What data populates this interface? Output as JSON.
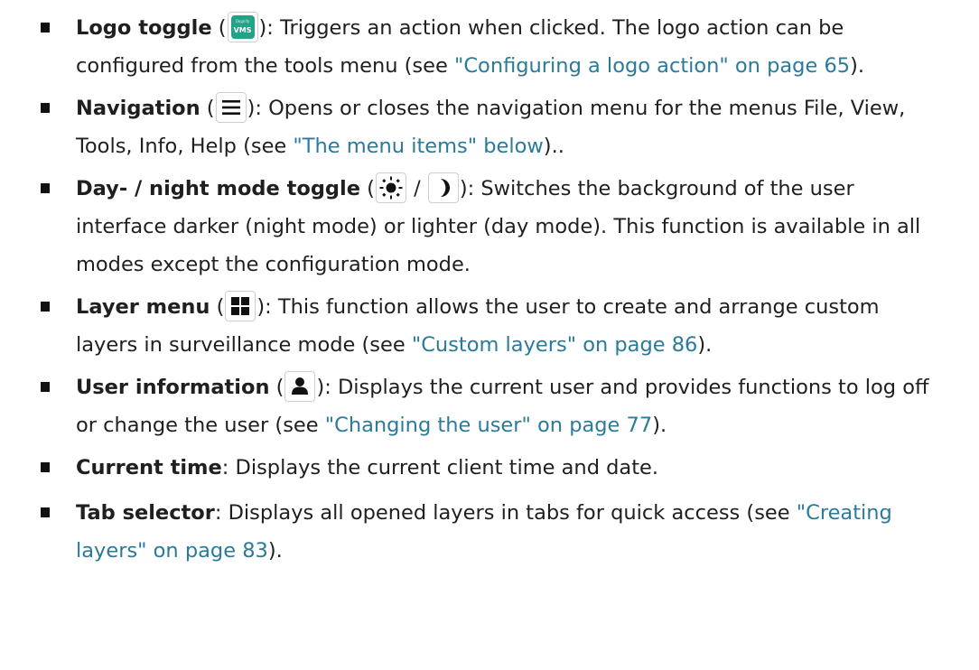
{
  "items": [
    {
      "parts": [
        {
          "t": "b",
          "text": "Logo toggle"
        },
        {
          "t": "s",
          "text": " ("
        },
        {
          "t": "icon",
          "icon": "logo-icon",
          "small": "Qognify",
          "big": "VMS"
        },
        {
          "t": "s",
          "text": "): Triggers an action when clicked. The logo action can be configured from the tools menu (see "
        },
        {
          "t": "a",
          "text": "\"Configuring a logo action\" on page 65"
        },
        {
          "t": "s",
          "text": ")."
        }
      ]
    },
    {
      "parts": [
        {
          "t": "b",
          "text": "Navigation"
        },
        {
          "t": "s",
          "text": " ("
        },
        {
          "t": "icon",
          "icon": "hamburger-menu-icon"
        },
        {
          "t": "s",
          "text": "): Opens or closes the navigation menu for the menus File, View, Tools, Info, Help (see "
        },
        {
          "t": "a",
          "text": "\"The menu items\" below"
        },
        {
          "t": "s",
          "text": ").."
        }
      ]
    },
    {
      "parts": [
        {
          "t": "b",
          "text": "Day- / night mode toggle"
        },
        {
          "t": "s",
          "text": " ("
        },
        {
          "t": "icon",
          "icon": "sun-icon"
        },
        {
          "t": "s",
          "text": " / "
        },
        {
          "t": "icon",
          "icon": "moon-icon"
        },
        {
          "t": "s",
          "text": "): Switches the background of the user interface darker (night mode) or lighter (day mode). This function is available in all modes except the configuration mode."
        }
      ]
    },
    {
      "parts": [
        {
          "t": "b",
          "text": "Layer menu"
        },
        {
          "t": "s",
          "text": " ("
        },
        {
          "t": "icon",
          "icon": "grid-icon"
        },
        {
          "t": "s",
          "text": "): This function allows the user to create and arrange custom layers in surveillance mode (see "
        },
        {
          "t": "a",
          "text": "\"Custom layers\" on page 86"
        },
        {
          "t": "s",
          "text": ")."
        }
      ]
    },
    {
      "parts": [
        {
          "t": "b",
          "text": "User information"
        },
        {
          "t": "s",
          "text": " ("
        },
        {
          "t": "icon",
          "icon": "user-icon"
        },
        {
          "t": "s",
          "text": "): Displays the current user and provides functions to log off or change the user (see "
        },
        {
          "t": "a",
          "text": "\"Changing the user\" on page 77"
        },
        {
          "t": "s",
          "text": ")."
        }
      ]
    },
    {
      "parts": [
        {
          "t": "b",
          "text": "Current time"
        },
        {
          "t": "s",
          "text": ": Displays the current client time and date."
        }
      ]
    },
    {
      "parts": [
        {
          "t": "b",
          "text": "Tab selector"
        },
        {
          "t": "s",
          "text": ": Displays all opened layers in tabs for quick access (see "
        },
        {
          "t": "a",
          "text": "\"Creating layers\" on page 83"
        },
        {
          "t": "s",
          "text": ")."
        }
      ]
    }
  ]
}
